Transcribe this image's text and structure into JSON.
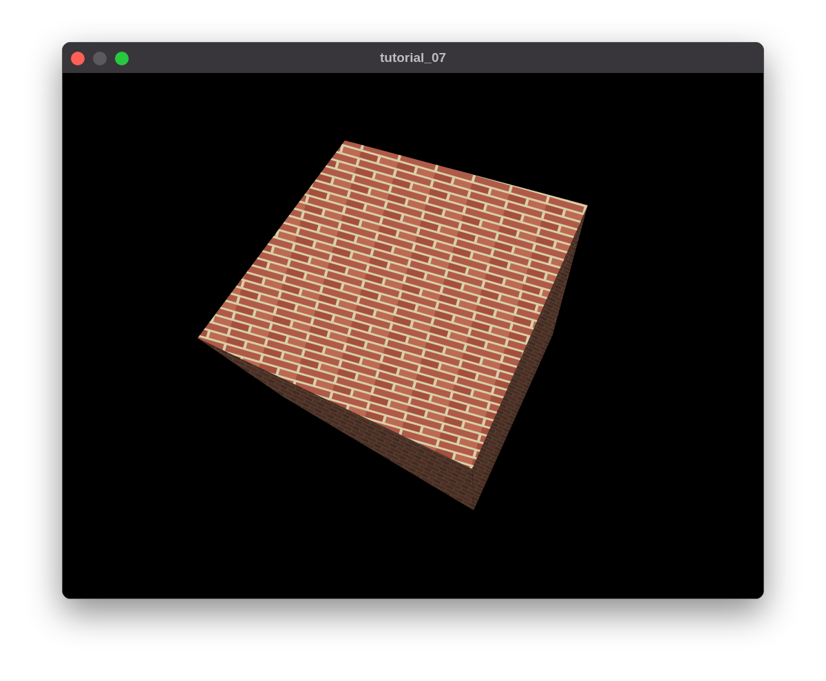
{
  "window": {
    "title": "tutorial_07",
    "controls": [
      {
        "kind": "close",
        "disabled": false
      },
      {
        "kind": "minimize",
        "disabled": true
      },
      {
        "kind": "zoom",
        "disabled": false
      }
    ]
  }
}
